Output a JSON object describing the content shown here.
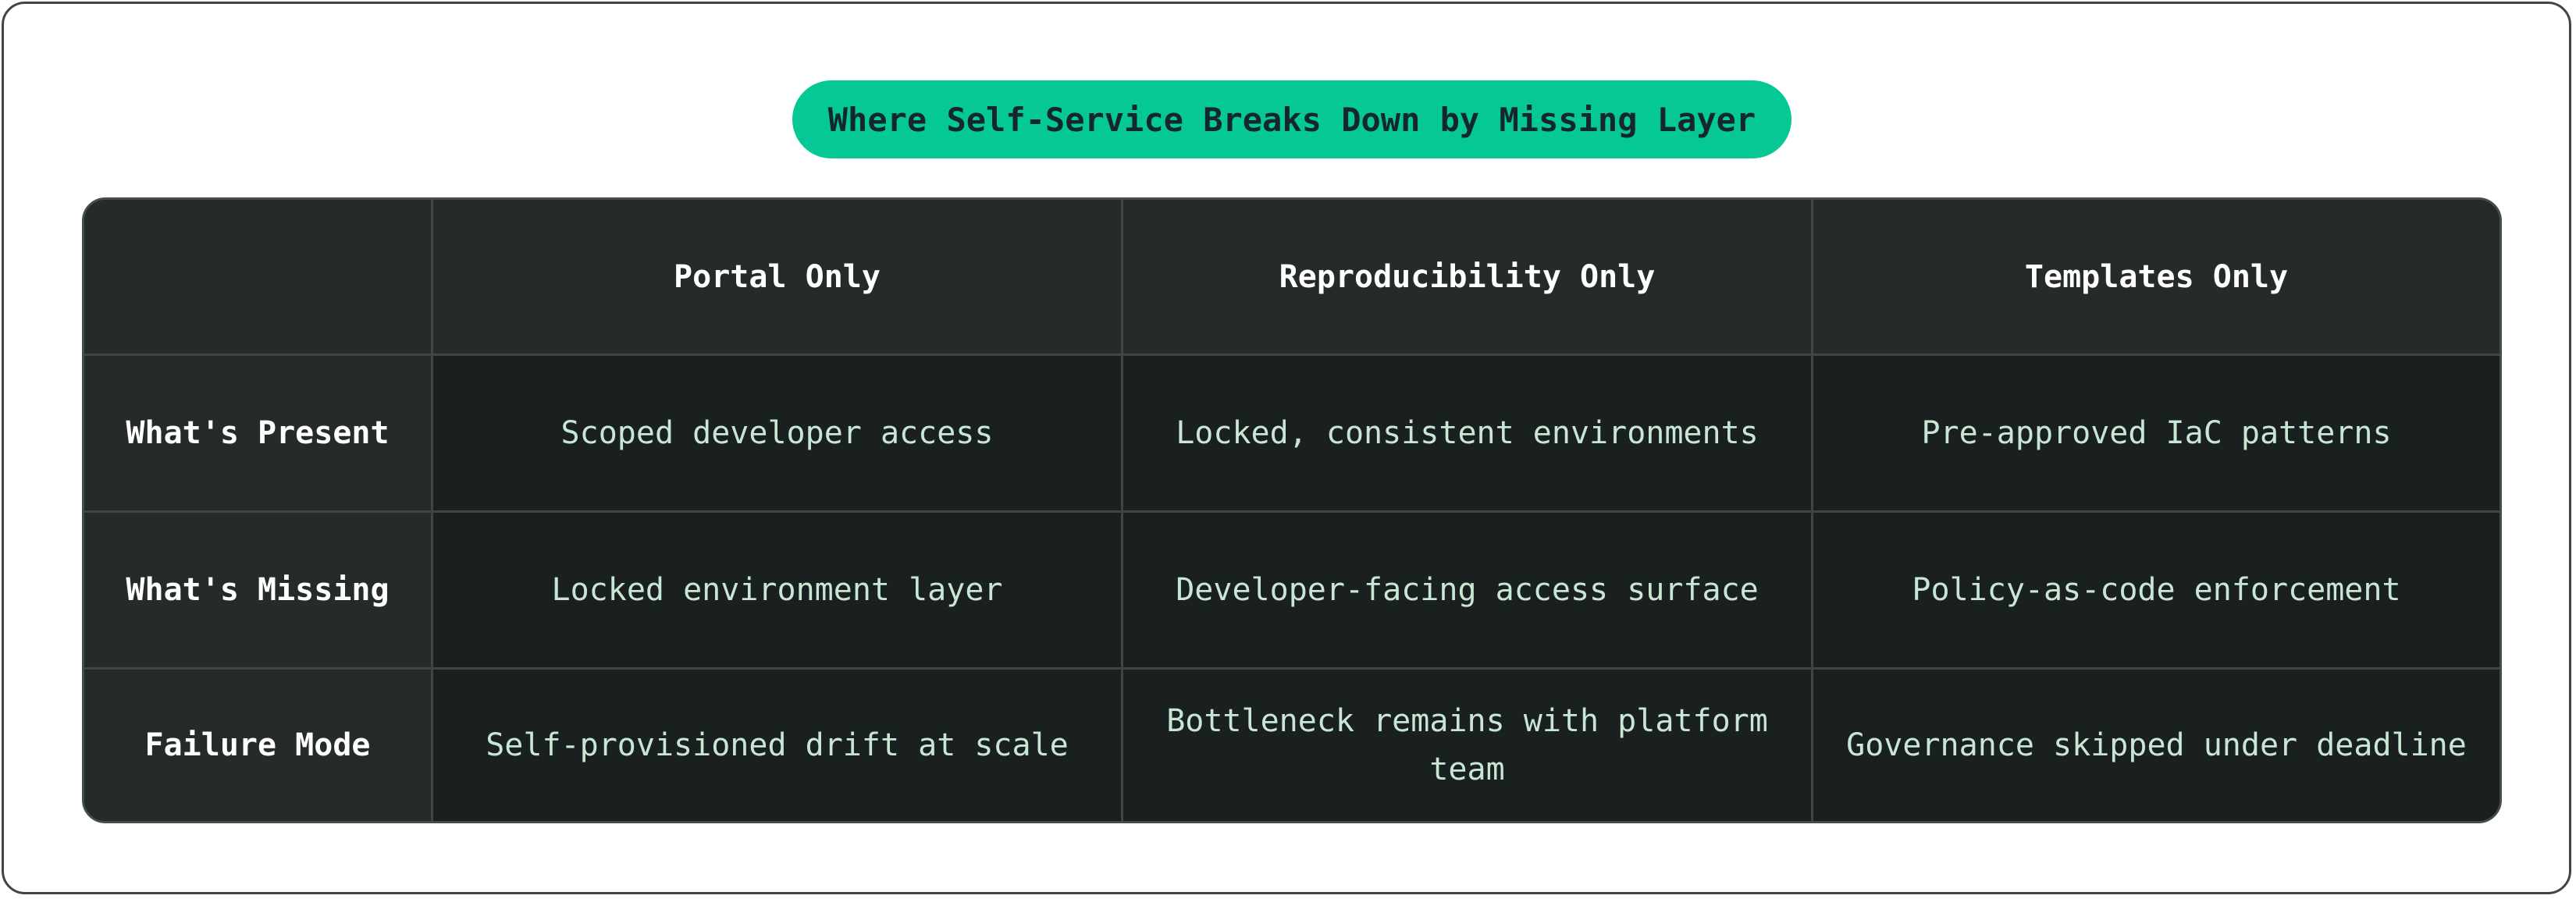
{
  "title": "Where Self-Service Breaks Down by Missing Layer",
  "table": {
    "corner": "",
    "columns": [
      "Portal Only",
      "Reproducibility Only",
      "Templates Only"
    ],
    "rows": [
      {
        "label": "What's Present",
        "cells": [
          "Scoped developer access",
          "Locked, consistent environments",
          "Pre-approved IaC patterns"
        ]
      },
      {
        "label": "What's Missing",
        "cells": [
          "Locked environment layer",
          "Developer-facing access surface",
          "Policy-as-code enforcement"
        ]
      },
      {
        "label": "Failure Mode",
        "cells": [
          "Self-provisioned drift at scale",
          "Bottleneck remains with platform team",
          "Governance skipped under deadline"
        ]
      }
    ]
  },
  "colors": {
    "accent": "#05c896",
    "table_bg": "#1a1f1f",
    "header_bg": "#252a2a",
    "body_text": "#c8e6d4"
  }
}
